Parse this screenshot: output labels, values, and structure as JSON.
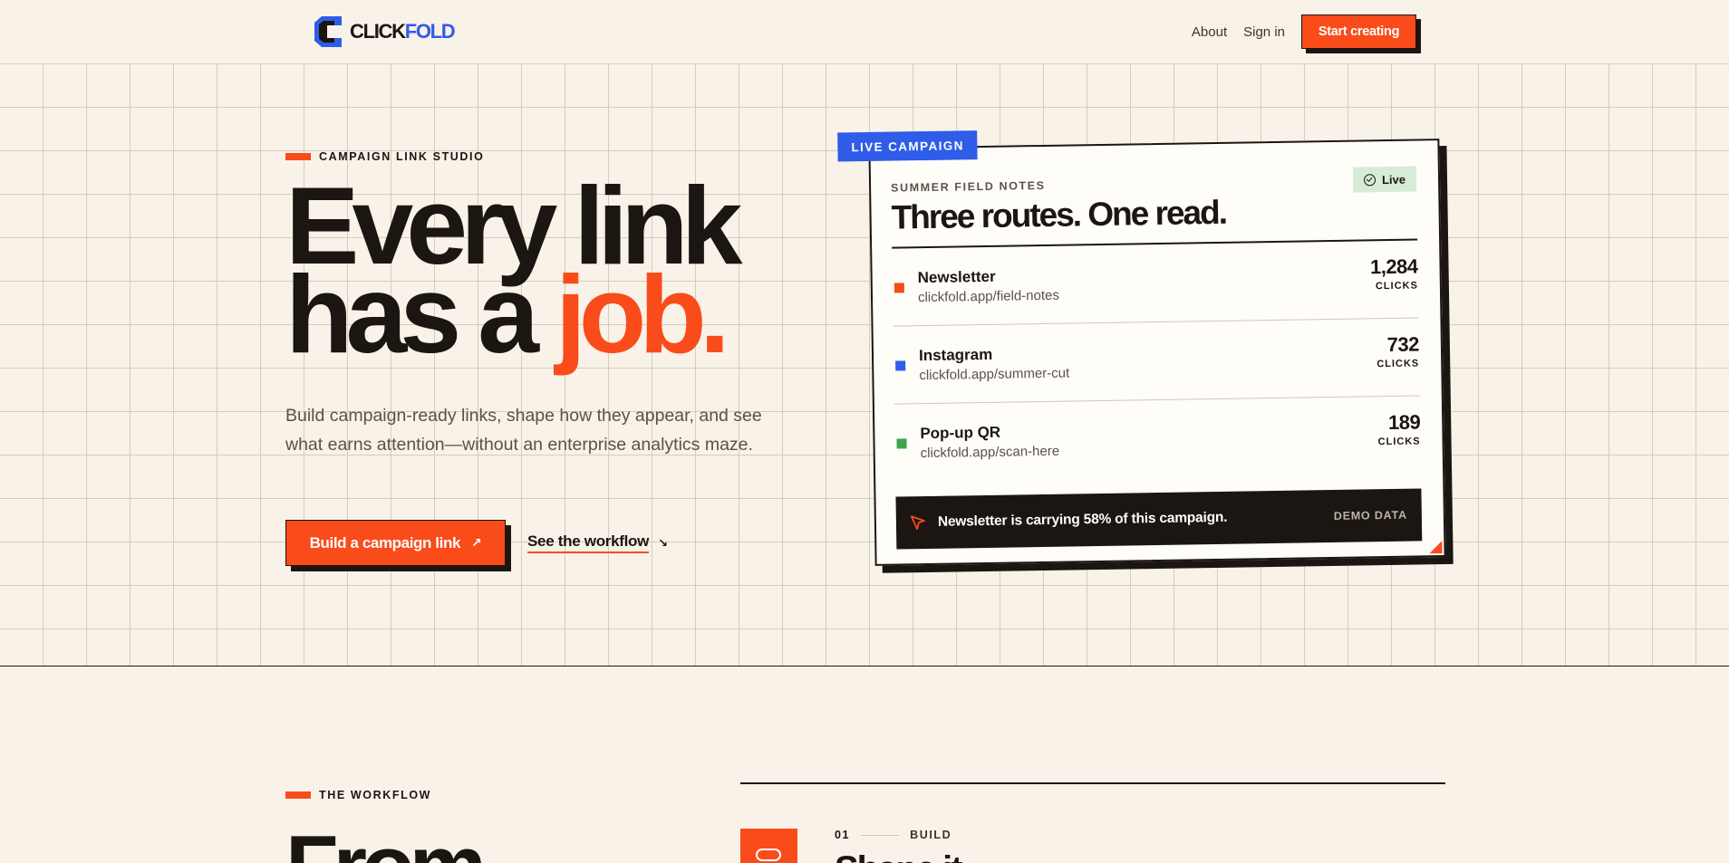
{
  "nav": {
    "logo_part1": "CLICK",
    "logo_part2": "FOLD",
    "about": "About",
    "signin": "Sign in",
    "cta": "Start creating"
  },
  "hero": {
    "eyebrow": "CAMPAIGN LINK STUDIO",
    "headline_line1": "Every link",
    "headline_line2_a": "has a ",
    "headline_line2_b": "job.",
    "subtitle": "Build campaign-ready links, shape how they appear, and see what earns attention—without an enterprise analytics maze.",
    "primary_button": "Build a campaign link",
    "secondary_link": "See the workflow"
  },
  "card": {
    "tag": "LIVE CAMPAIGN",
    "eyebrow": "SUMMER FIELD NOTES",
    "title": "Three routes. One read.",
    "badge": "Live",
    "routes": [
      {
        "name": "Newsletter",
        "url": "clickfold.app/field-notes",
        "clicks": "1,284",
        "unit": "CLICKS",
        "color": "#f04e1f"
      },
      {
        "name": "Instagram",
        "url": "clickfold.app/summer-cut",
        "clicks": "732",
        "unit": "CLICKS",
        "color": "#2f5ce8"
      },
      {
        "name": "Pop-up QR",
        "url": "clickfold.app/scan-here",
        "clicks": "189",
        "unit": "CLICKS",
        "color": "#3fa34d"
      }
    ],
    "insight": "Newsletter is carrying 58% of this campaign.",
    "demo_label": "DEMO DATA"
  },
  "workflow": {
    "eyebrow": "THE WORKFLOW",
    "heading": "From",
    "step_number": "01",
    "step_label": "BUILD",
    "step_title": "Shape it"
  },
  "colors": {
    "accent": "#fa4b1b",
    "brand_blue": "#2f5ce8",
    "ink": "#1b1612",
    "paper": "#f8f2e8"
  }
}
